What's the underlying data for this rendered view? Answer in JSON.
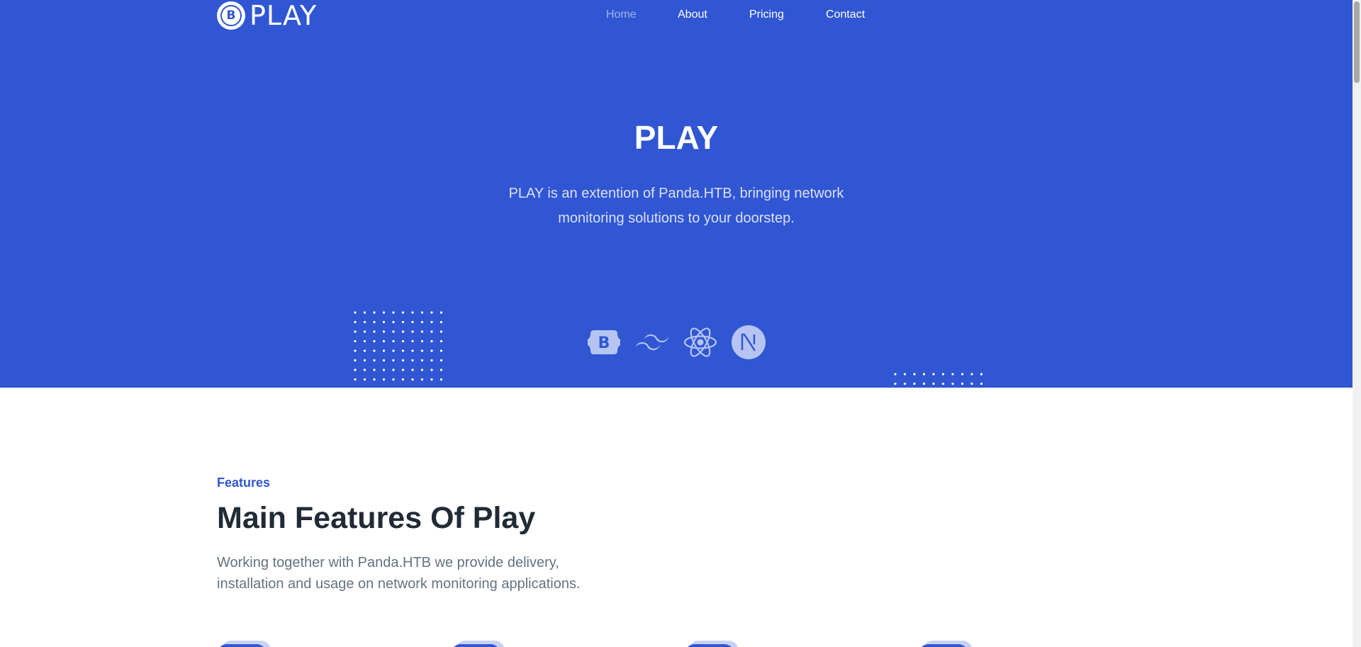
{
  "brand": {
    "logo_letter": "B",
    "name": "PLAY"
  },
  "nav": {
    "items": [
      {
        "label": "Home",
        "active": true
      },
      {
        "label": "About",
        "active": false
      },
      {
        "label": "Pricing",
        "active": false
      },
      {
        "label": "Contact",
        "active": false
      }
    ]
  },
  "hero": {
    "title": "PLAY",
    "subtitle": "PLAY is an extention of Panda.HTB, bringing network monitoring solutions to your doorstep.",
    "tech_icons": [
      "bootstrap-icon",
      "tailwind-icon",
      "react-icon",
      "nextjs-icon"
    ]
  },
  "features": {
    "tag": "Features",
    "title": "Main Features Of Play",
    "description": "Working together with Panda.HTB we provide delivery, installation and usage on network monitoring applications."
  },
  "colors": {
    "primary": "#3056d3",
    "heading": "#212b36",
    "body_text": "#637381",
    "white": "#ffffff"
  }
}
